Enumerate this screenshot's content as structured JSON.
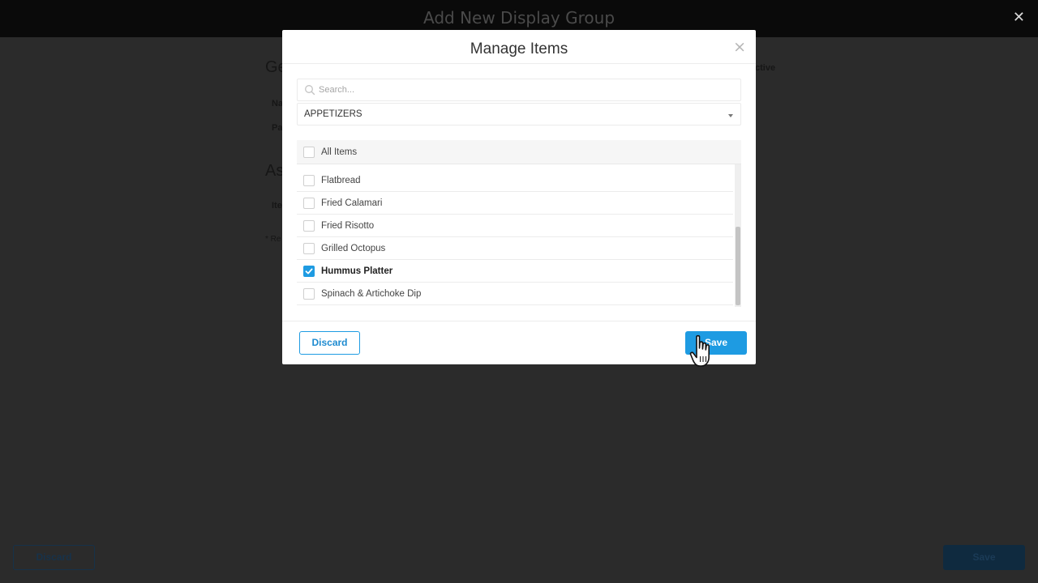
{
  "background": {
    "title": "Add New Display Group",
    "heading_general": "Ge",
    "heading_assign": "As",
    "label_name": "Na",
    "label_pa": "Pa",
    "label_ite": "Ite",
    "label_re": "* Re",
    "active_text": "ctive",
    "discard_label": "Discard",
    "save_label": "Save"
  },
  "modal": {
    "title": "Manage Items",
    "close_glyph": "×",
    "search_placeholder": "Search...",
    "category_selected": "APPETIZERS",
    "all_items_label": "All Items",
    "items": [
      {
        "label": "Flatbread",
        "checked": false
      },
      {
        "label": "Fried Calamari",
        "checked": false
      },
      {
        "label": "Fried Risotto",
        "checked": false
      },
      {
        "label": "Grilled Octopus",
        "checked": false
      },
      {
        "label": "Hummus Platter",
        "checked": true
      },
      {
        "label": "Spinach & Artichoke Dip",
        "checked": false
      }
    ],
    "discard_label": "Discard",
    "save_label": "Save"
  },
  "colors": {
    "accent": "#1e9be2",
    "overlay": "#2b2b2b",
    "header_bg": "#0a0a0a"
  }
}
